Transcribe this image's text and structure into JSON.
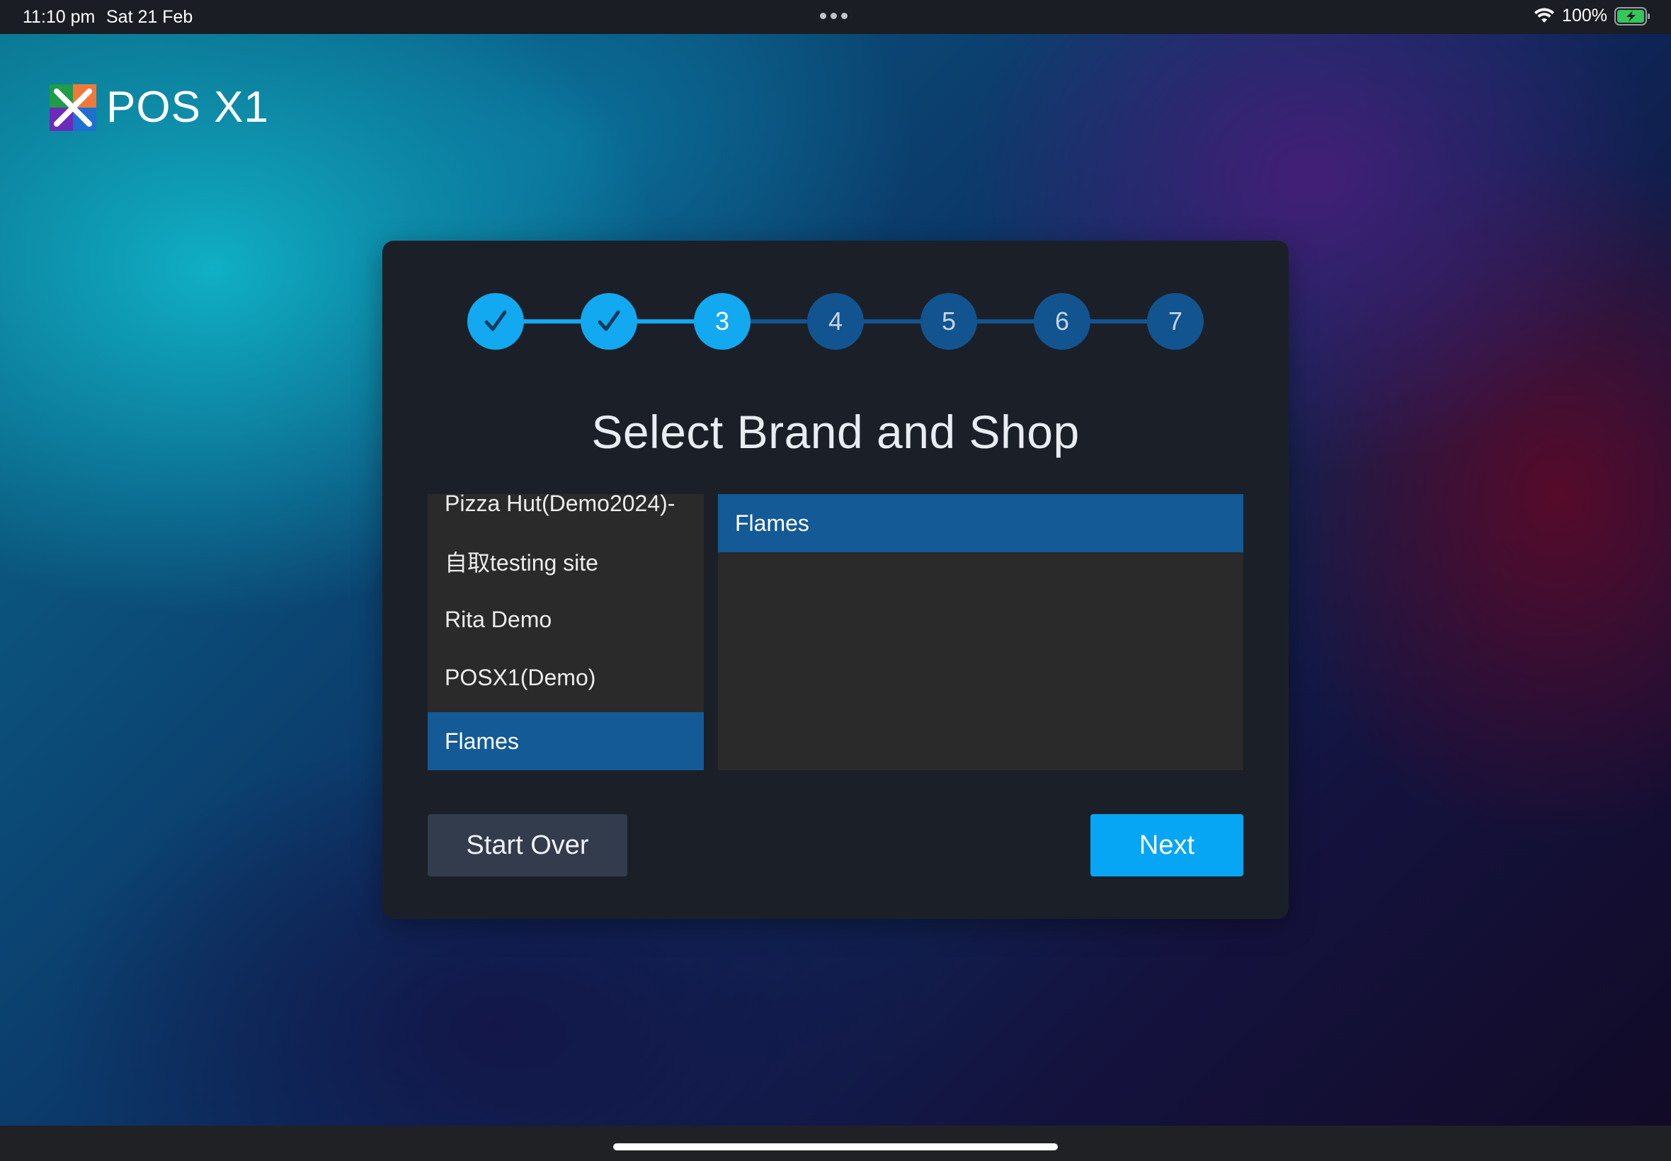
{
  "status_bar": {
    "time": "11:10 pm",
    "date": "Sat 21 Feb",
    "battery": "100%",
    "icons": [
      "wifi-icon",
      "battery-charging-icon"
    ]
  },
  "app": {
    "name": "POS X1",
    "logo_icon": "pos-x1-logo-icon"
  },
  "stepper": {
    "steps": [
      {
        "label": "",
        "state": "done"
      },
      {
        "label": "",
        "state": "done"
      },
      {
        "label": "3",
        "state": "current"
      },
      {
        "label": "4",
        "state": "todo"
      },
      {
        "label": "5",
        "state": "todo"
      },
      {
        "label": "6",
        "state": "todo"
      },
      {
        "label": "7",
        "state": "todo"
      }
    ],
    "done_icon": "check-icon"
  },
  "dialog": {
    "title": "Select Brand and Shop"
  },
  "brands": {
    "items": [
      {
        "label": "Pizza Hut(Demo2024)-"
      },
      {
        "label": "自取testing site"
      },
      {
        "label": "Rita Demo"
      },
      {
        "label": "POSX1(Demo)"
      },
      {
        "label": "Flames",
        "selected": true
      }
    ]
  },
  "shops": {
    "items": [
      {
        "label": "Flames",
        "selected": true
      }
    ]
  },
  "actions": {
    "start_over": "Start Over",
    "next": "Next"
  },
  "colors": {
    "accent": "#12a9f0",
    "selected_row": "#135a96",
    "card_bg": "#1b2028",
    "list_bg": "#2a2a2a",
    "secondary_button": "#323c4d",
    "step_todo": "#12548f"
  }
}
